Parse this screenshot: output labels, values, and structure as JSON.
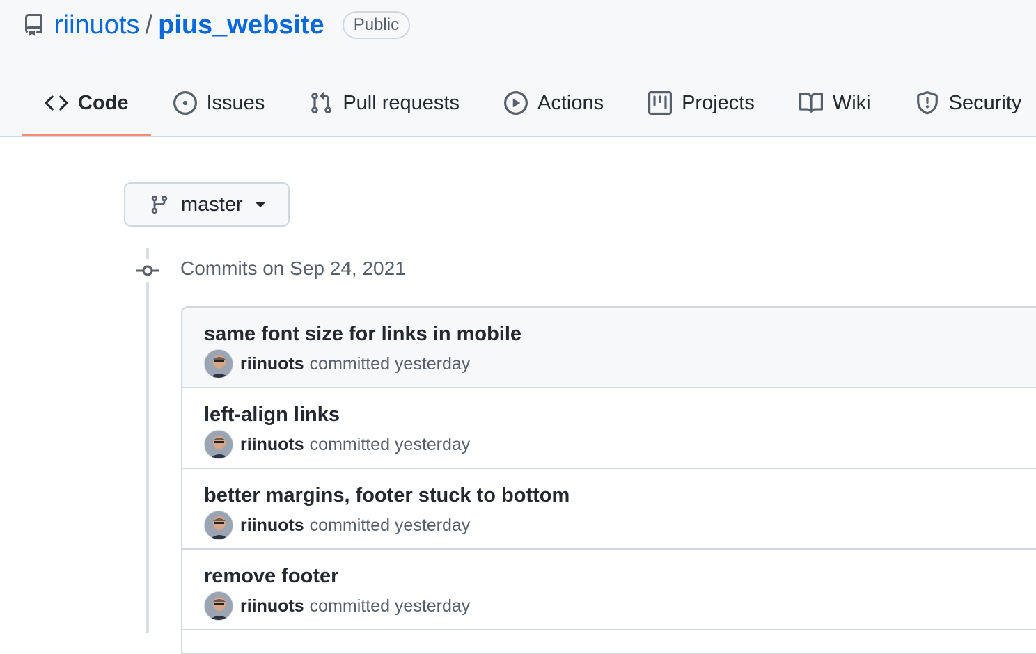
{
  "repo": {
    "owner": "riinuots",
    "separator": "/",
    "name": "pius_website",
    "visibility": "Public"
  },
  "tabs": [
    {
      "label": "Code",
      "icon": "code-icon",
      "selected": true
    },
    {
      "label": "Issues",
      "icon": "issue-opened-icon",
      "selected": false
    },
    {
      "label": "Pull requests",
      "icon": "git-pull-request-icon",
      "selected": false
    },
    {
      "label": "Actions",
      "icon": "play-icon",
      "selected": false
    },
    {
      "label": "Projects",
      "icon": "project-icon",
      "selected": false
    },
    {
      "label": "Wiki",
      "icon": "book-icon",
      "selected": false
    },
    {
      "label": "Security",
      "icon": "shield-icon",
      "selected": false
    }
  ],
  "branch": {
    "name": "master",
    "icon": "git-branch-icon"
  },
  "commit_group": {
    "date_label": "Commits on Sep 24, 2021",
    "commits": [
      {
        "message": "same font size for links in mobile",
        "author": "riinuots",
        "action": "committed yesterday"
      },
      {
        "message": "left-align links",
        "author": "riinuots",
        "action": "committed yesterday"
      },
      {
        "message": "better margins, footer stuck to bottom",
        "author": "riinuots",
        "action": "committed yesterday"
      },
      {
        "message": "remove footer",
        "author": "riinuots",
        "action": "committed yesterday"
      }
    ]
  },
  "colors": {
    "link": "#0969da",
    "selected_tab_underline": "#fd8c73",
    "header_bg": "#f6f8fa",
    "border": "#d0d7de",
    "muted_text": "#57606a"
  }
}
